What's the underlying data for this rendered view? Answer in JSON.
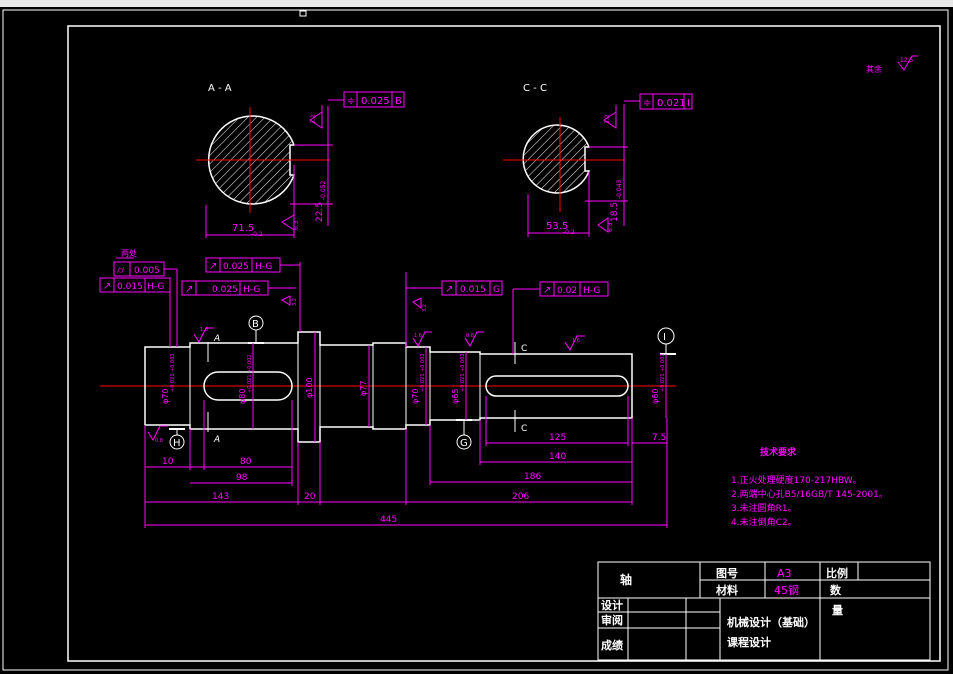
{
  "sections": {
    "aa": {
      "label": "A - A",
      "tol": "0.025",
      "datum": "B",
      "width": "71.5",
      "width_tol": "-0.2",
      "depth": "22.5",
      "depth_tol": "-0.052",
      "rough1": "3.2",
      "rough2": "6.3"
    },
    "cc": {
      "label": "C - C",
      "tol": "0.021",
      "datum": "I",
      "width": "53.5",
      "width_tol": "-0.2",
      "depth": "18.5",
      "depth_tol": "-0.043",
      "rough1": "3.2",
      "rough2": "6.3"
    }
  },
  "top_right": {
    "text": "其余",
    "roughness": "12.5"
  },
  "fcf": {
    "left_title": "两处",
    "f1_val": "0.005",
    "f2_val": "0.015",
    "f2_ref": "H-G",
    "f3_val": "0.025",
    "f3_ref": "H-G",
    "f4_val": "0.025",
    "f4_ref": "H-G",
    "f5_val": "0.015",
    "f5_ref": "G",
    "f6_val": "0.02",
    "f6_ref": "H-G"
  },
  "roughness": {
    "r1": "1.6",
    "r2": "3.2",
    "r3": "0.8",
    "r4": "1.6",
    "r5": "3.2",
    "r6": "1.6",
    "r7": "0.8"
  },
  "datums": {
    "b": "B",
    "h": "H",
    "g": "G",
    "i": "I"
  },
  "section_marks": {
    "a_top": "A",
    "a_bot": "A",
    "c_top": "C",
    "c_bot": "C"
  },
  "diameters": {
    "d1": "φ70",
    "d1_tol": "+0.021 +0.002",
    "d2": "φ80",
    "d2_tol": "+0.021 +0.002",
    "d3": "φ100",
    "d4": "φ77",
    "d5": "φ70",
    "d5_tol": "+0.021 +0.002",
    "d6": "φ65",
    "d6_tol": "+0.021 +0.002",
    "d7": "φ60",
    "d7_tol": "+0.021 +0.002"
  },
  "dims": {
    "d10": "10",
    "d80": "80",
    "d98": "98",
    "d143": "143",
    "d20": "20",
    "d206": "206",
    "d445": "445",
    "d125": "125",
    "d140": "140",
    "d186": "186",
    "d7_5": "7.5"
  },
  "notes": {
    "title": "技术要求",
    "items": [
      "1.正火处理硬度170-217HBW。",
      "2.两端中心孔B5/16GB/T 145-2001。",
      "3.未注圆角R1。",
      "4.未注倒角C2。"
    ]
  },
  "title_block": {
    "part_name": "轴",
    "drawing_no_label": "图号",
    "drawing_no": "A3",
    "material_label": "材料",
    "material": "45钢",
    "scale_label": "比例",
    "qty_label": "数",
    "qty2": "量",
    "design": "设计",
    "review": "审阅",
    "grade": "成绩",
    "course": "机械设计（基础）",
    "course2": "课程设计"
  }
}
